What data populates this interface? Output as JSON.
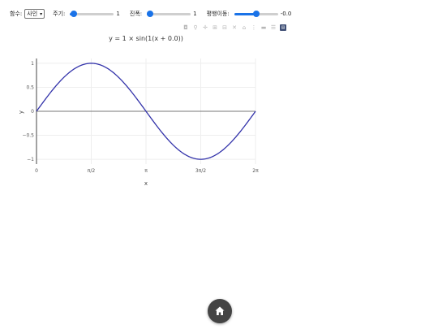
{
  "controls": {
    "function_label": "함수:",
    "function_value": "사인",
    "period_label": "주기:",
    "period_value": "1",
    "period_fraction": 0.08,
    "amplitude_label": "진폭:",
    "amplitude_value": "1",
    "amplitude_fraction": 0.08,
    "shift_label": "평행이동:",
    "shift_value": "-0.0",
    "shift_fraction": 0.5,
    "accent_color": "#1a73e8"
  },
  "modebar": {
    "icons": [
      "camera-icon",
      "zoom-icon",
      "pan-icon",
      "zoom-in-icon",
      "zoom-out-icon",
      "autoscale-icon",
      "reset-axes-icon",
      "spike-lines-icon",
      "hover-closest-icon",
      "hover-compare-icon",
      "plotly-logo-icon"
    ]
  },
  "home_button": {
    "icon": "home-icon"
  },
  "chart_data": {
    "type": "line",
    "title": "y = 1 × sin(1(x + 0.0))",
    "xlabel": "x",
    "ylabel": "y",
    "xlim": [
      0,
      6.2832
    ],
    "ylim": [
      -1.1,
      1.1
    ],
    "grid": true,
    "line_color": "#3333aa",
    "function": "sin",
    "amplitude": 1,
    "period_factor": 1,
    "shift": 0,
    "x_ticks": [
      0,
      1.5708,
      3.1416,
      4.7124,
      6.2832
    ],
    "x_tick_labels": [
      "0",
      "π/2",
      "π",
      "3π/2",
      "2π"
    ],
    "y_ticks": [
      -1,
      -0.5,
      0,
      0.5,
      1
    ],
    "y_tick_labels": [
      "−1",
      "−0.5",
      "0",
      "0.5",
      "1"
    ]
  }
}
